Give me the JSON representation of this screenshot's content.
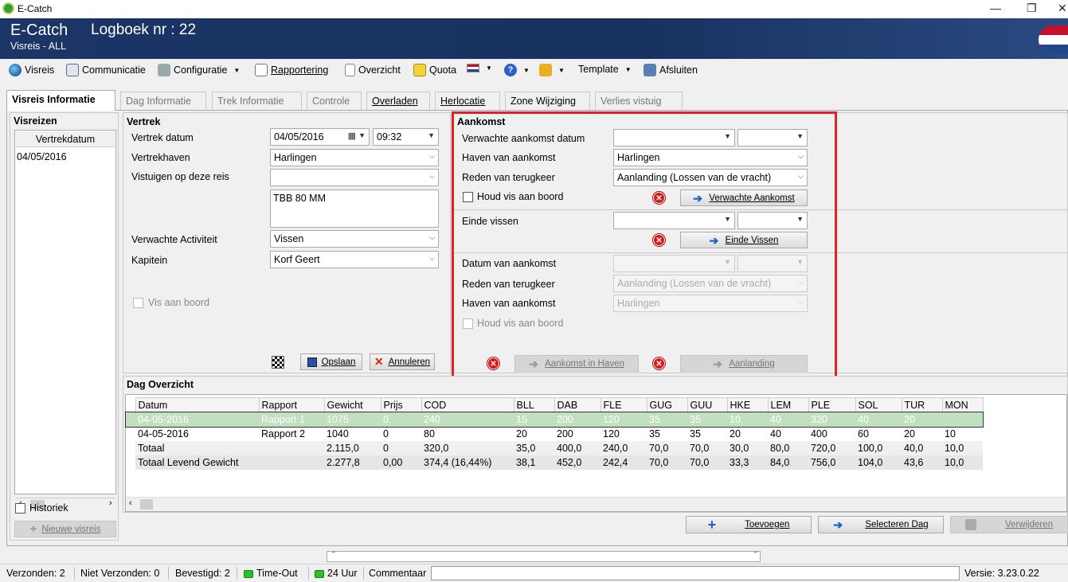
{
  "window": {
    "title": "E-Catch",
    "controls": [
      "—",
      "❐",
      "✕"
    ]
  },
  "header": {
    "app": "E-Catch",
    "subtitle": "Visreis - ALL",
    "logbook": "Logboek nr : 22"
  },
  "menu": [
    {
      "label": "Visreis"
    },
    {
      "label": "Communicatie"
    },
    {
      "label": "Configuratie"
    },
    {
      "label": "Rapportering"
    },
    {
      "label": "Overzicht"
    },
    {
      "label": "Quota"
    },
    {
      "label": "Template"
    },
    {
      "label": "Afsluiten"
    }
  ],
  "tabs": [
    "Visreis Informatie",
    "Dag Informatie",
    "Trek Informatie",
    "Controle",
    "Overladen",
    "Herlocatie",
    "Zone Wijziging",
    "Verlies vistuig"
  ],
  "sidebar": {
    "title": "Visreizen",
    "column": "Vertrekdatum",
    "rows": [
      "04/05/2016"
    ],
    "history_label": "Historiek",
    "new_trip": "Nieuwe visreis"
  },
  "vertrek": {
    "title": "Vertrek",
    "datum_label": "Vertrek datum",
    "datum": "04/05/2016",
    "tijd": "09:32",
    "haven_label": "Vertrekhaven",
    "haven": "Harlingen",
    "vistuigen_label": "Vistuigen op deze reis",
    "vistuigen_value": "",
    "vistuigen_list": "TBB 80 MM",
    "activiteit_label": "Verwachte Activiteit",
    "activiteit": "Vissen",
    "kapitein_label": "Kapitein",
    "kapitein": "Korf Geert",
    "vis_aan_boord": "Vis aan boord",
    "save": "Opslaan",
    "cancel": "Annuleren"
  },
  "aankomst": {
    "title": "Aankomst",
    "verwacht_datum_label": "Verwachte aankomst datum",
    "verwacht_datum": "",
    "verwacht_tijd": "",
    "haven_label": "Haven van aankomst",
    "haven": "Harlingen",
    "reden_label": "Reden van terugkeer",
    "reden": "Aanlanding (Lossen van de vracht)",
    "houd_vis": "Houd vis aan boord",
    "btn_verwacht": "Verwachte Aankomst",
    "einde_label": "Einde vissen",
    "btn_einde": "Einde Vissen",
    "datum_aankomst_label": "Datum van aankomst",
    "reden2_label": "Reden van terugkeer",
    "reden2": "Aanlanding (Lossen van de vracht)",
    "haven2_label": "Haven van aankomst",
    "haven2": "Harlingen",
    "houd_vis2": "Houd vis aan boord",
    "btn_aankomst_haven": "Aankomst in Haven",
    "btn_aanlanding": "Aanlanding",
    "highlight_color": "#e0212a"
  },
  "dag_overzicht": {
    "title": "Dag Overzicht",
    "columns": [
      "Datum",
      "Rapport",
      "Gewicht",
      "Prijs",
      "COD",
      "BLL",
      "DAB",
      "FLE",
      "GUG",
      "GUU",
      "HKE",
      "LEM",
      "PLE",
      "SOL",
      "TUR",
      "MON"
    ],
    "rows": [
      [
        "04-05-2016",
        "Rapport 1",
        "1075",
        "0",
        "240",
        "15",
        "200",
        "120",
        "35",
        "35",
        "10",
        "40",
        "320",
        "40",
        "20",
        ""
      ],
      [
        "04-05-2016",
        "Rapport 2",
        "1040",
        "0",
        "80",
        "20",
        "200",
        "120",
        "35",
        "35",
        "20",
        "40",
        "400",
        "60",
        "20",
        "10"
      ],
      [
        "Totaal",
        "",
        "2.115,0",
        "0",
        "320,0",
        "35,0",
        "400,0",
        "240,0",
        "70,0",
        "70,0",
        "30,0",
        "80,0",
        "720,0",
        "100,0",
        "40,0",
        "10,0"
      ],
      [
        "Totaal Levend Gewicht",
        "",
        "2.277,8",
        "0,00",
        "374,4 (16,44%)",
        "38,1",
        "452,0",
        "242,4",
        "70,0",
        "70,0",
        "33,3",
        "84,0",
        "756,0",
        "104,0",
        "43,6",
        "10,0"
      ]
    ],
    "btn_add": "Toevoegen",
    "btn_select": "Selecteren Dag",
    "btn_delete": "Verwijderen"
  },
  "status": {
    "verzonden": "Verzonden: 2",
    "niet_verzonden": "Niet Verzonden: 0",
    "bevestigd": "Bevestigd: 2",
    "timeout": "Time-Out",
    "uur": "24 Uur",
    "commentaar": "Commentaar",
    "versie": "Versie: 3.23.0.22"
  }
}
